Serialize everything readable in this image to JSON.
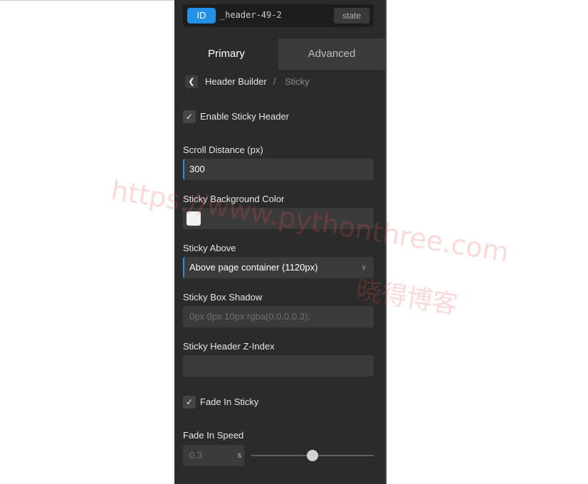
{
  "element": {
    "badge": "ID",
    "name": "_header-49-2",
    "state_label": "state"
  },
  "tabs": {
    "primary": "Primary",
    "advanced": "Advanced"
  },
  "breadcrumb": {
    "parent": "Header Builder",
    "separator": "/",
    "current": "Sticky"
  },
  "enable_sticky": {
    "label": "Enable Sticky Header",
    "checked": true
  },
  "scroll_distance": {
    "label": "Scroll Distance (px)",
    "value": "300"
  },
  "sticky_bg": {
    "label": "Sticky Background Color",
    "color": "#f2f2f2"
  },
  "sticky_above": {
    "label": "Sticky Above",
    "value": "Above page container (1120px)"
  },
  "box_shadow": {
    "label": "Sticky Box Shadow",
    "placeholder": "0px 0px 10px rgba(0,0,0,0.3);"
  },
  "z_index": {
    "label": "Sticky Header Z-Index",
    "value": ""
  },
  "fade_in": {
    "label": "Fade In Sticky",
    "checked": true
  },
  "fade_speed": {
    "label": "Fade In Speed",
    "value": "0.3",
    "unit": "s",
    "slider_fraction": 0.5
  },
  "watermark": {
    "url": "https://www.pythonthree.com",
    "cn": "晓得博客"
  },
  "colors": {
    "accent": "#2490e6",
    "panel_bg": "#2b2b2b",
    "field_bg": "#3b3b3b"
  },
  "icons": {
    "back": "chevron-left-icon",
    "check": "check-icon",
    "dropdown": "chevron-down-icon"
  }
}
